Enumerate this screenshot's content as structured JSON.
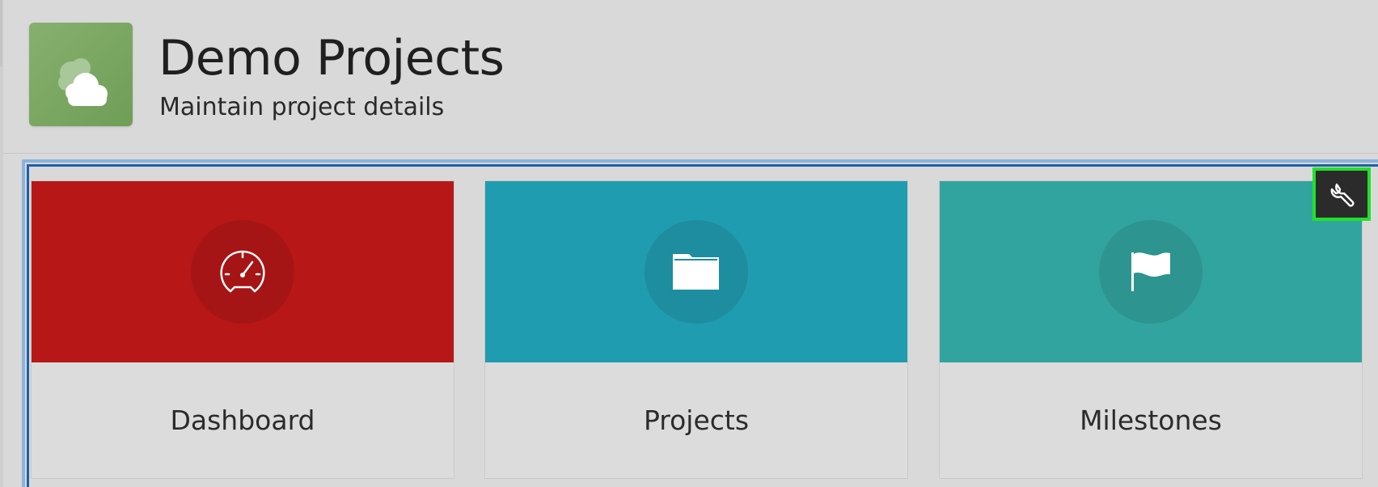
{
  "header": {
    "title": "Demo Projects",
    "subtitle": "Maintain project details",
    "app_icon": "cloud-icon",
    "app_icon_color": "#7aa863"
  },
  "cards": [
    {
      "label": "Dashboard",
      "icon": "speedometer-icon",
      "band_color": "#b71717"
    },
    {
      "label": "Projects",
      "icon": "folder-icon",
      "band_color": "#209cb0"
    },
    {
      "label": "Milestones",
      "icon": "flag-icon",
      "band_color": "#32a49f"
    }
  ],
  "toolbar": {
    "customize_icon": "wrench-icon",
    "highlight_color": "#22e12a"
  },
  "region": {
    "border_color": "#1f5fa8"
  }
}
